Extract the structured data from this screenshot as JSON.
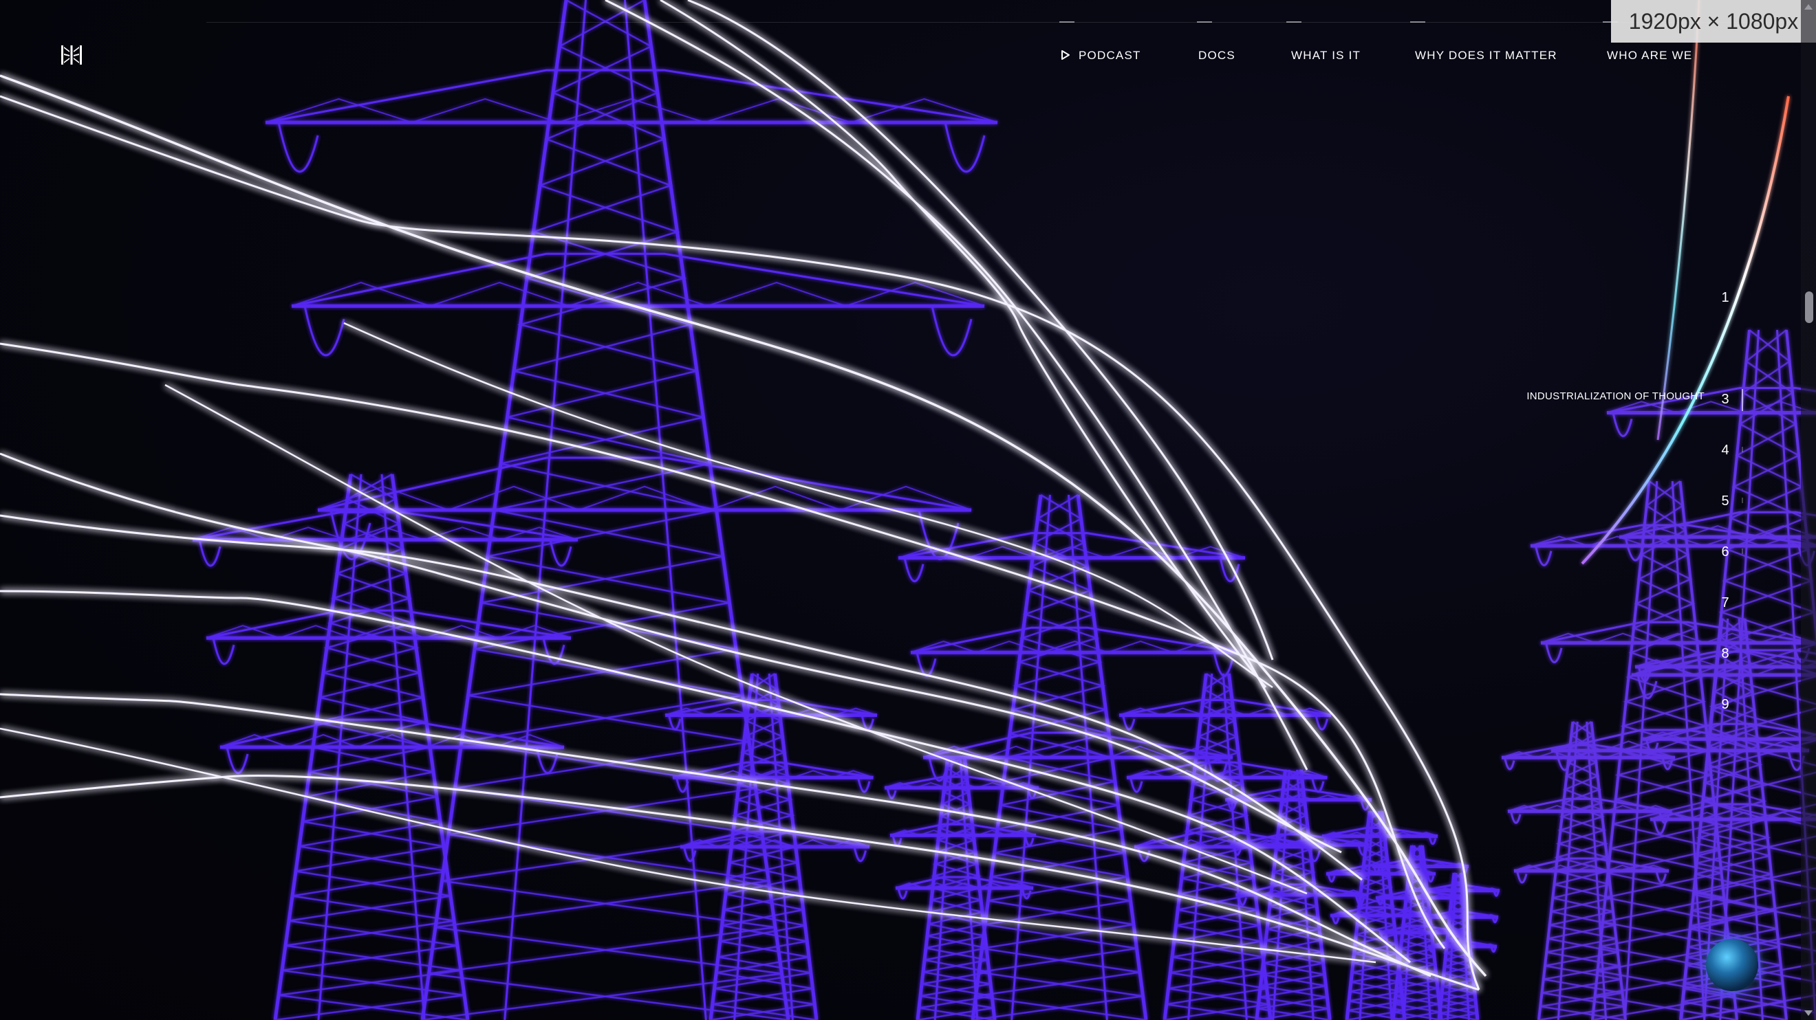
{
  "nav": {
    "items": [
      {
        "label": "PODCAST"
      },
      {
        "label": "DOCS"
      },
      {
        "label": "WHAT IS IT"
      },
      {
        "label": "WHY DOES IT MATTER"
      },
      {
        "label": "WHO ARE WE"
      }
    ]
  },
  "size_badge": "1920px × 1080px",
  "sections": {
    "numbers": [
      "1",
      "3",
      "4",
      "5",
      "6",
      "7",
      "8",
      "9"
    ],
    "active": "3",
    "active_label": "INDUSTRIALIZATION OF THOUGHT"
  },
  "colors": {
    "tower": "#5b2cff",
    "cable": "#f4f1ff",
    "background": "#05050d",
    "nav_text": "#ffffff"
  },
  "icons": {
    "logo": "grid-logo-icon",
    "podcast": "play-icon",
    "orb": "globe-orb-icon"
  }
}
